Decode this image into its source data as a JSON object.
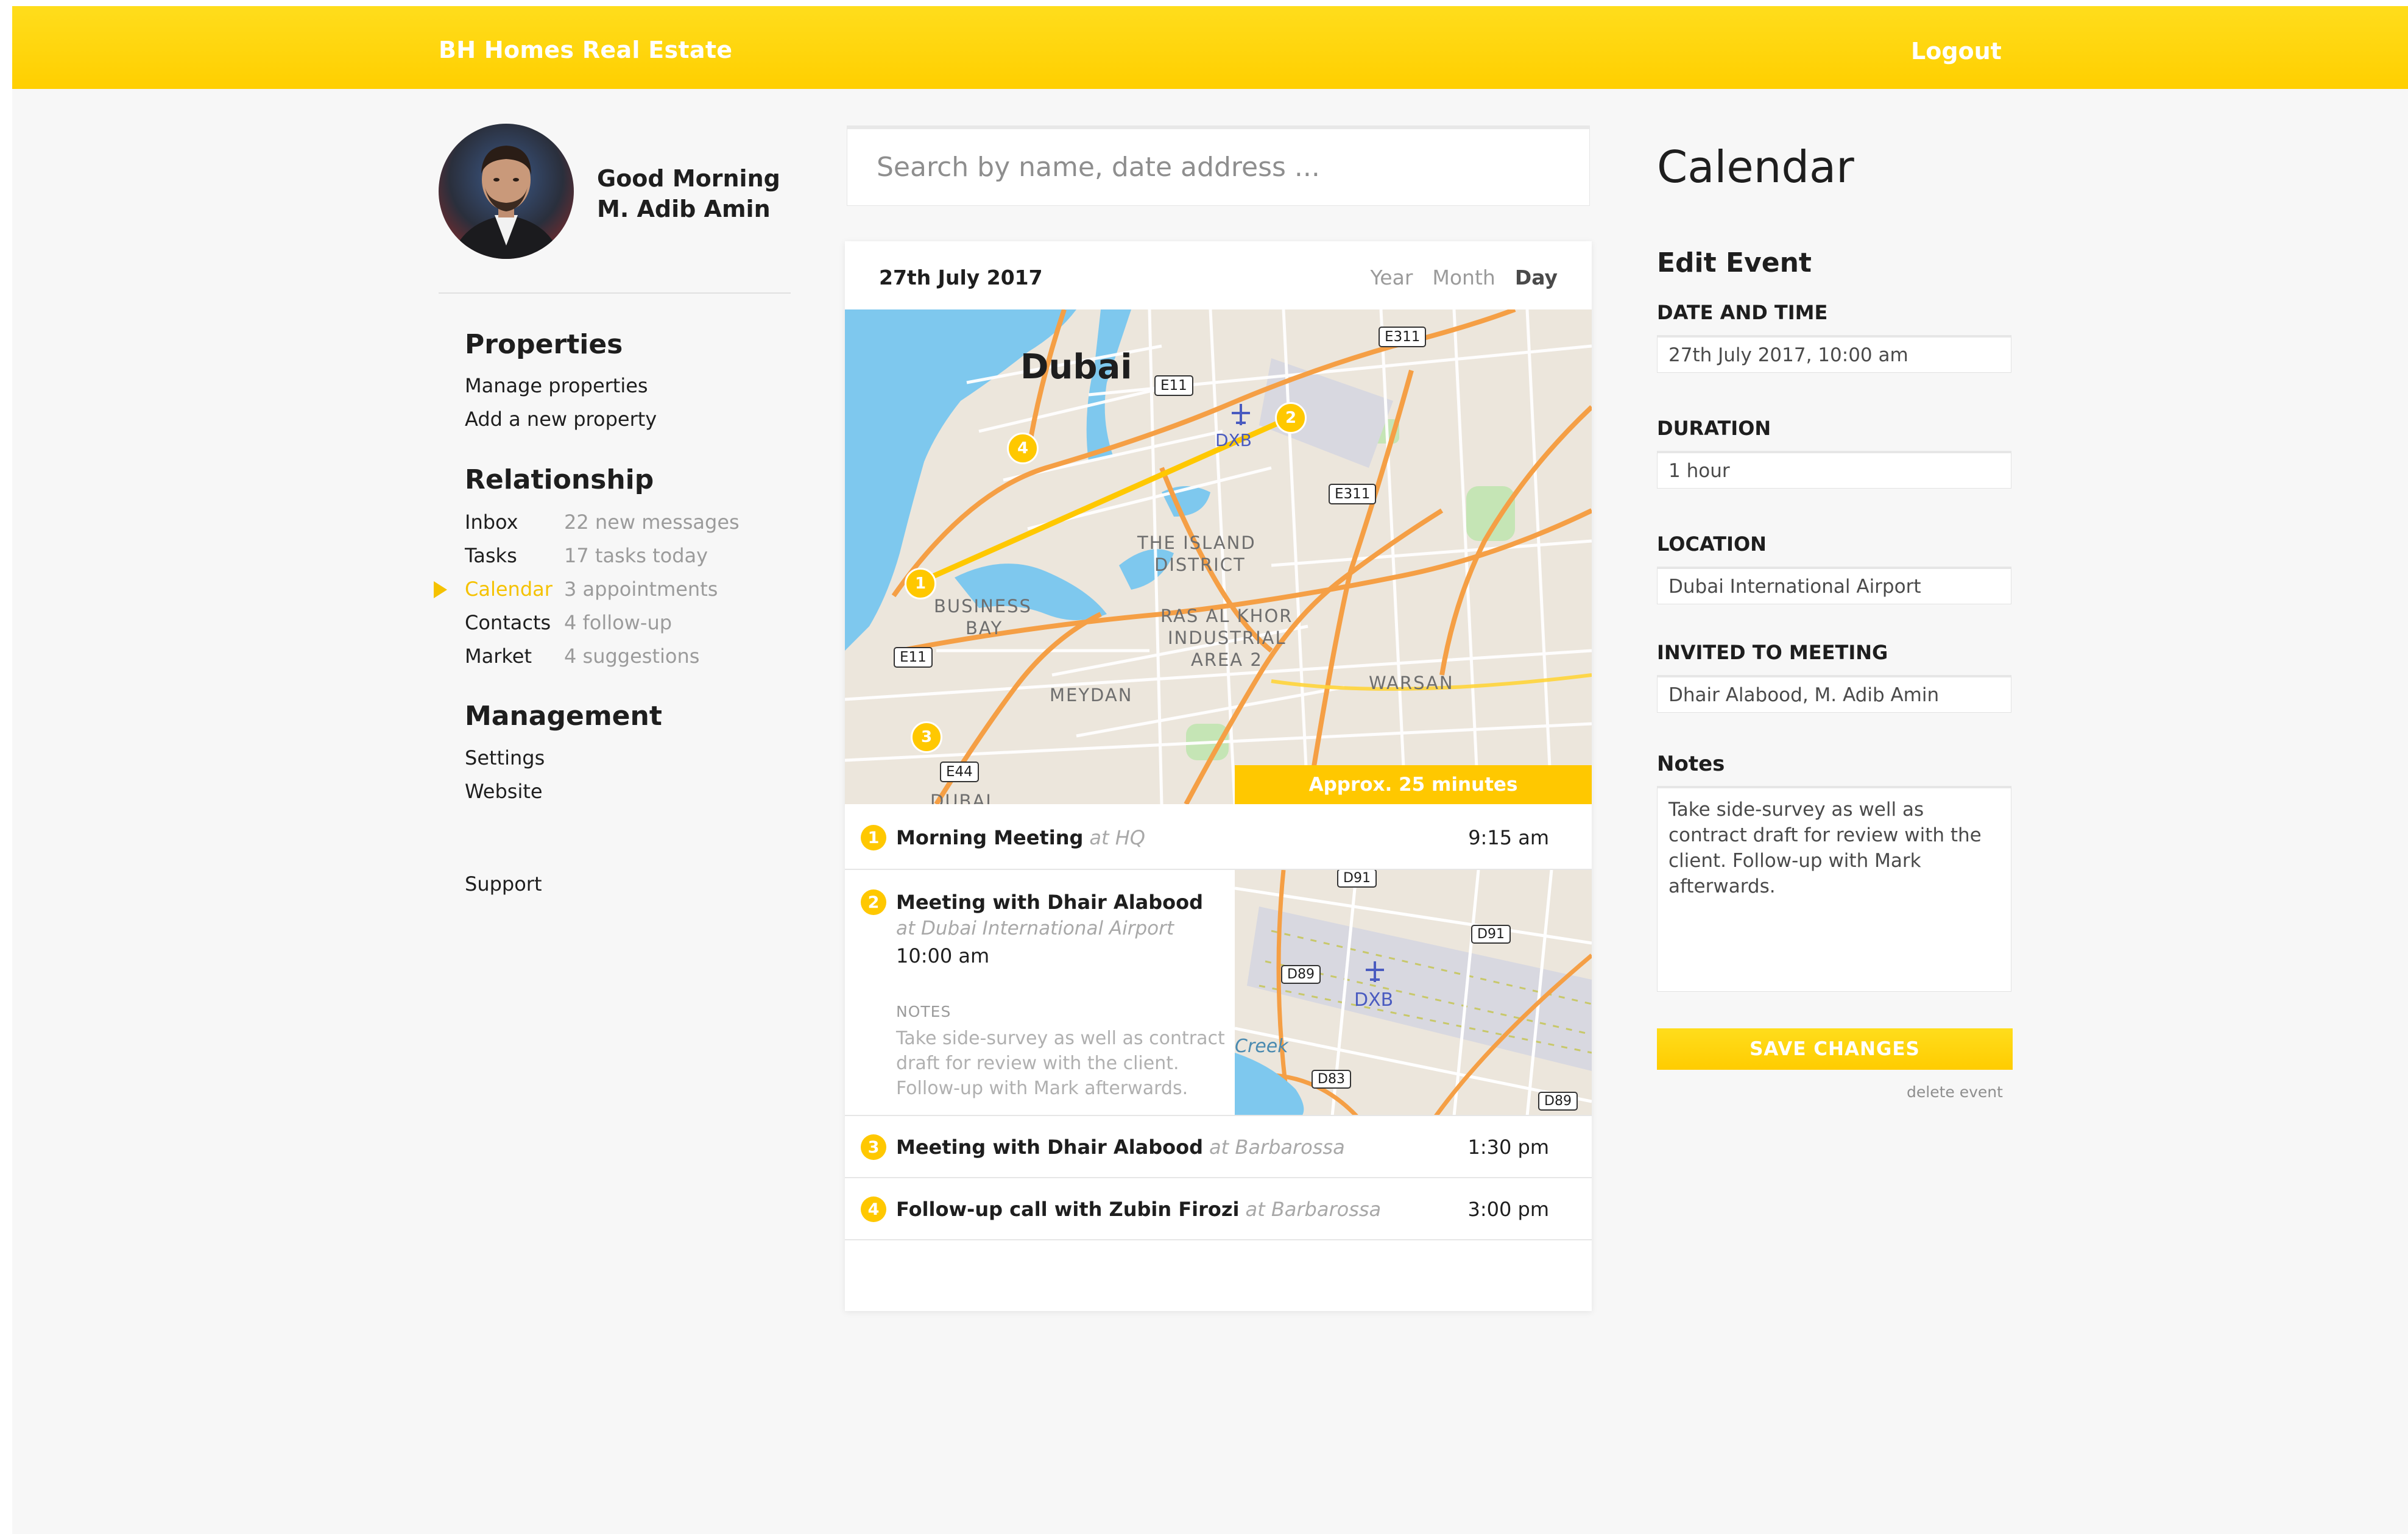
{
  "header": {
    "brand": "BH Homes Real Estate",
    "logout": "Logout"
  },
  "user": {
    "greeting": "Good Morning",
    "name": "M. Adib Amin"
  },
  "sidebar": {
    "sections": [
      {
        "title": "Properties",
        "items": [
          {
            "label": "Manage properties",
            "meta": ""
          },
          {
            "label": "Add a new property",
            "meta": ""
          }
        ]
      },
      {
        "title": "Relationship",
        "items": [
          {
            "label": "Inbox",
            "meta": "22 new messages"
          },
          {
            "label": "Tasks",
            "meta": "17 tasks today"
          },
          {
            "label": "Calendar",
            "meta": "3 appointments"
          },
          {
            "label": "Contacts",
            "meta": "4 follow-up"
          },
          {
            "label": "Market",
            "meta": "4 suggestions"
          }
        ]
      },
      {
        "title": "Management",
        "items": [
          {
            "label": "Settings",
            "meta": ""
          },
          {
            "label": "Website",
            "meta": ""
          }
        ]
      }
    ],
    "support": "Support",
    "active_item": "Calendar"
  },
  "search": {
    "placeholder": "Search by name, date address ..."
  },
  "schedule": {
    "date": "27th July 2017",
    "views": [
      "Year",
      "Month",
      "Day"
    ],
    "active_view": "Day",
    "travel": "Approx. 25 minutes",
    "events": [
      {
        "num": "1",
        "title": "Morning Meeting",
        "location": "at HQ",
        "time": "9:15 am"
      },
      {
        "num": "2",
        "title": "Meeting with Dhair Alabood",
        "location": "at Dubai International Airport",
        "time": "10:00 am",
        "notes_label": "NOTES",
        "notes": "Take side-survey as well as contract draft for review with the client. Follow-up with Mark afterwards."
      },
      {
        "num": "3",
        "title": "Meeting with Dhair Alabood",
        "location": "at Barbarossa",
        "time": "1:30 pm"
      },
      {
        "num": "4",
        "title": "Follow-up call with Zubin Firozi",
        "location": "at Barbarossa",
        "time": "3:00 pm"
      }
    ]
  },
  "map": {
    "city": "Dubai",
    "airport": "DXB",
    "districts": [
      "THE ISLAND",
      "DISTRICT",
      "BUSINESS",
      "BAY",
      "RAS AL KHOR",
      "INDUSTRIAL",
      "AREA 2",
      "MEYDAN",
      "WARSAN",
      "DUBAI"
    ],
    "roads": [
      "E311",
      "E11",
      "E311",
      "E11",
      "E44"
    ],
    "markers": [
      "1",
      "2",
      "3",
      "4"
    ],
    "small_roads": [
      "D91",
      "D91",
      "D89",
      "D83",
      "D89"
    ],
    "creek": "Creek"
  },
  "edit": {
    "page_title": "Calendar",
    "title": "Edit Event",
    "date_label": "DATE AND TIME",
    "date_value": "27th July 2017, 10:00 am",
    "duration_label": "DURATION",
    "duration_value": "1 hour",
    "location_label": "LOCATION",
    "location_value": "Dubai International Airport",
    "invited_label": "INVITED TO MEETING",
    "invited_value": "Dhair Alabood, M. Adib Amin",
    "notes_label": "Notes",
    "notes_value": "Take side-survey as well as contract draft for review with the client. Follow-up with Mark afterwards.",
    "save": "SAVE CHANGES",
    "delete": "delete event"
  },
  "colors": {
    "accent": "#ffc800",
    "header": "#ffd500",
    "background": "#f7f7f7",
    "water": "#7ec8ee",
    "road": "#f59f45",
    "route": "#ffc800"
  },
  "icons": {
    "active_marker": "triangle-right",
    "airport": "airplane-icon"
  }
}
